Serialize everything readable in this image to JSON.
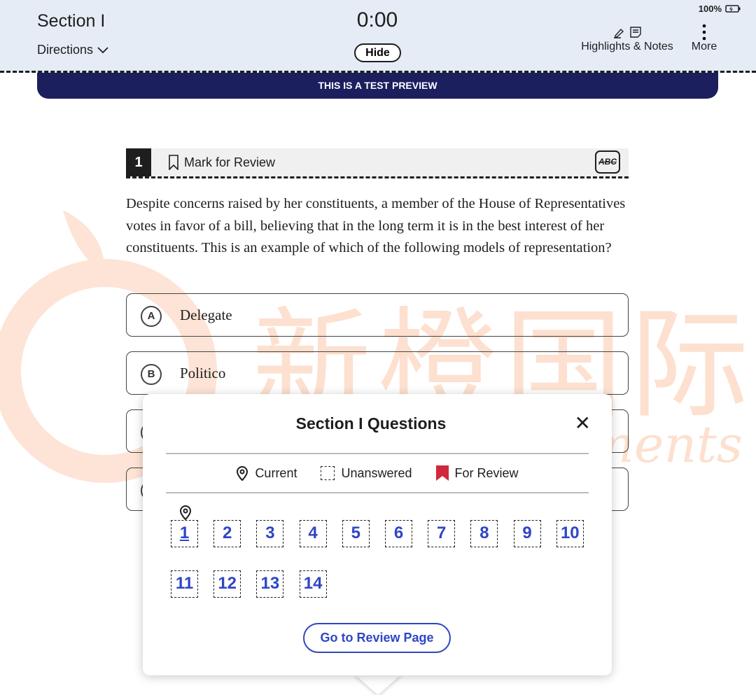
{
  "header": {
    "section_title": "Section I",
    "directions_label": "Directions",
    "timer": "0:00",
    "hide_label": "Hide",
    "battery": "100%",
    "highlights_label": "Highlights & Notes",
    "more_label": "More"
  },
  "banner": "THIS IS A TEST PREVIEW",
  "question": {
    "number": "1",
    "mark_label": "Mark for Review",
    "abc_label": "ABC",
    "text": "Despite concerns raised by her constituents, a member of the House of Representatives votes in favor of a bill, believing that in the long term it is in the best interest of her constituents. This is an example of which of the following models of representation?",
    "options": [
      {
        "letter": "A",
        "text": "Delegate"
      },
      {
        "letter": "B",
        "text": "Politico"
      }
    ]
  },
  "watermark": {
    "cn": "新橙国际",
    "en": "New Achievements",
    "color": "#fbd9c6"
  },
  "popup": {
    "title": "Section I Questions",
    "legend": {
      "current": "Current",
      "unanswered": "Unanswered",
      "review": "For Review"
    },
    "numbers": [
      "1",
      "2",
      "3",
      "4",
      "5",
      "6",
      "7",
      "8",
      "9",
      "10",
      "11",
      "12",
      "13",
      "14"
    ],
    "current": "1",
    "review_button": "Go to Review Page"
  },
  "colors": {
    "accent": "#2f46c4",
    "banner": "#1b1f5e",
    "review_flag": "#d0283c",
    "header_bg": "#e5ecf6"
  }
}
